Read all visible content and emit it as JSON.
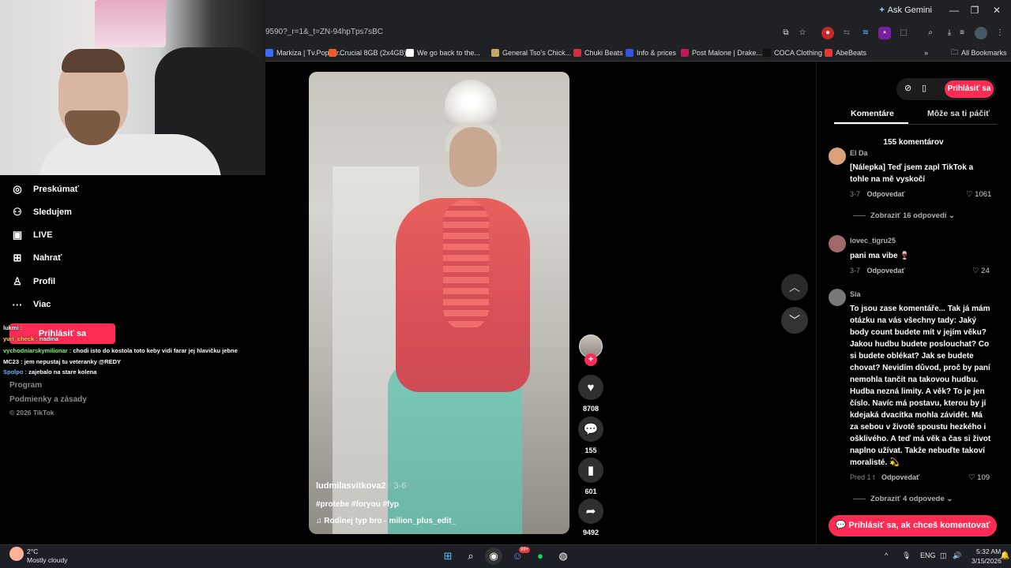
{
  "browser": {
    "url": "9590?_r=1&_t=ZN-94hpTps7sBC",
    "ask_gemini": "Ask Gemini",
    "bookmarks": [
      {
        "label": "Markiza | Tv.Popcor...",
        "color": "#3b6cff"
      },
      {
        "label": "Crucial 8GB (2x4GB)...",
        "color": "#f05a28"
      },
      {
        "label": "We go back to the...",
        "color": "#ffffff"
      },
      {
        "label": "General Tso's Chick...",
        "color": "#c8a46a"
      },
      {
        "label": "Chuki Beats",
        "color": "#d0303c"
      },
      {
        "label": "Info & prices",
        "color": "#3455db"
      },
      {
        "label": "Post Malone | Drake...",
        "color": "#c2185b"
      },
      {
        "label": "COCA Clothing",
        "color": "#111111"
      },
      {
        "label": "AbeBeats",
        "color": "#e53935"
      }
    ],
    "all_bookmarks": "All Bookmarks"
  },
  "sidebar": {
    "items": [
      {
        "label": "Preskúmať",
        "icon": "compass-icon"
      },
      {
        "label": "Sledujem",
        "icon": "people-icon"
      },
      {
        "label": "LIVE",
        "icon": "live-tv-icon"
      },
      {
        "label": "Nahrať",
        "icon": "upload-plus-icon"
      },
      {
        "label": "Profil",
        "icon": "person-icon"
      },
      {
        "label": "Viac",
        "icon": "more-dots-icon"
      }
    ],
    "login_label": "Prihlásiť sa",
    "footer": {
      "program": "Program",
      "terms": "Podmienky a zásady",
      "copyright": "© 2026 TikTok"
    }
  },
  "chat": [
    {
      "user": "lukmi :",
      "text": "",
      "color": "#ffffff"
    },
    {
      "user": "yuri_check :",
      "text": "nadina",
      "color": "#ffd84d"
    },
    {
      "user": "vychodniarskymilionar :",
      "text": "chodi isto do kostola toto keby vidi farar jej hlavičku jebne",
      "color": "#7CFC66"
    },
    {
      "user": "MC23 :",
      "text": "jem nepustaj tu veteranky @REDY",
      "color": "#ffffff"
    },
    {
      "user": "Spolpo :",
      "text": "zajebalo na stare kolena",
      "color": "#6fb0ff"
    }
  ],
  "video": {
    "author": "ludmilasvitkova2",
    "date": " · 3-6",
    "tags": "#protebe #foryou #fyp",
    "music": "Rodinej typ bro - milion_plus_edit_"
  },
  "actions": {
    "likes": "8708",
    "comments": "155",
    "saves": "601",
    "shares": "9492"
  },
  "panel": {
    "login_label": "Prihlásiť sa",
    "tabs": [
      "Komentáre",
      "Môže sa ti páčiť"
    ],
    "comment_count": "155 komentárov",
    "comments": [
      {
        "name": "El Da",
        "text": "[Nálepka] Teď jsem zapl TikTok a tohle na mě vyskočí",
        "date": "3-7",
        "reply": "Odpovedať",
        "likes": "1061",
        "more": "Zobraziť 16 odpovedí",
        "avatar_color": "#d9a27a"
      },
      {
        "name": "lovec_tigru25",
        "text": "pani ma vibe 🍷",
        "date": "3-7",
        "reply": "Odpovedať",
        "likes": "24",
        "avatar_color": "#a06a6a"
      },
      {
        "name": "Sia",
        "text": "To jsou zase komentáře... Tak já mám otázku na vás všechny tady: Jaký body count budete mít v jejím věku? Jakou hudbu budete poslouchat? Co si budete oblékat? Jak se budete chovat? Nevidím důvod, proč by paní nemohla tančit na takovou hudbu. Hudba nezná limity. A věk? To je jen číslo. Navíc má postavu, kterou by jí kdejaká dvacítka mohla závidět. Má za sebou v životě spoustu hezkého i ošklivého. A teď má věk a čas si život naplno užívat. Takže nebuďte takoví moralisté. 💫",
        "date": "Pred 1 t",
        "reply": "Odpovedať",
        "likes": "109",
        "more": "Zobraziť 4 odpovede",
        "avatar_color": "#777777"
      }
    ],
    "cta": "Prihlásiť sa, ak chceš komentovať"
  },
  "taskbar": {
    "weather_temp": "2°C",
    "weather_desc": "Mostly cloudy",
    "lang": "ENG",
    "time": "5:32 AM",
    "date": "3/15/2026",
    "badge": "99+"
  },
  "colors": {
    "accent": "#fe2c55",
    "background": "#000000"
  }
}
